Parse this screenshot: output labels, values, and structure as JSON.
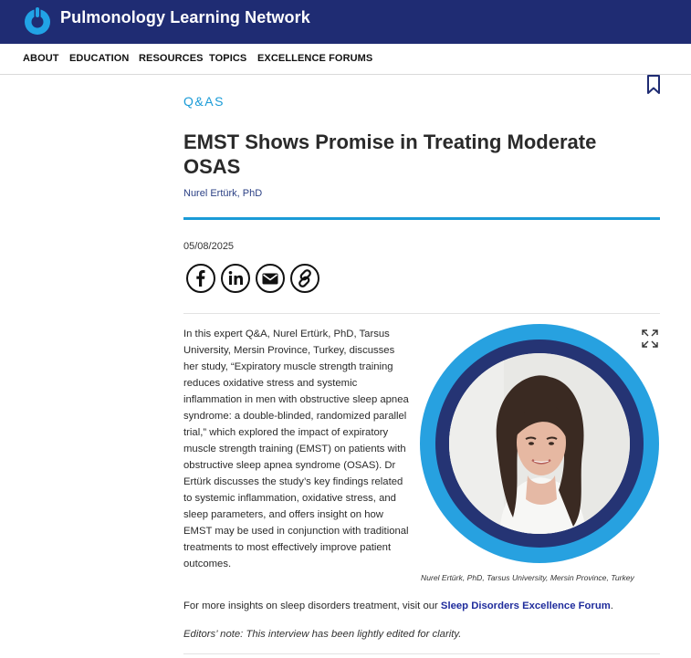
{
  "header": {
    "site_title": "Pulmonology Learning Network",
    "brand_color": "#1f2c73",
    "logo_icon": "lung-c-icon"
  },
  "nav": {
    "items": [
      {
        "label": "ABOUT"
      },
      {
        "label": "EDUCATION"
      },
      {
        "label": "RESOURCES"
      },
      {
        "label": "TOPICS"
      },
      {
        "label": "EXCELLENCE FORUMS"
      }
    ]
  },
  "article": {
    "category": "Q&AS",
    "title": "EMST Shows Promise in Treating Moderate OSAS",
    "author": "Nurel Ertürk, PhD",
    "date": "05/08/2025",
    "accent_color": "#1a9bd7",
    "share_icons": [
      "facebook-icon",
      "linkedin-icon",
      "email-icon",
      "link-icon"
    ],
    "bookmark_icon": "bookmark-icon",
    "expand_icon": "expand-icon",
    "body": "In this expert Q&A, Nurel Ertürk, PhD, Tarsus University, Mersin Province, Turkey, discusses her study, “Expiratory muscle strength training reduces oxidative stress and systemic inflammation in men with obstructive sleep apnea syndrome: a double-blinded, randomized parallel trial,” which explored the impact of expiratory muscle strength training (EMST) on patients with obstructive sleep apnea syndrome (OSAS). Dr Ertürk discusses the study’s key findings related to systemic inflammation, oxidative stress, and sleep parameters, and offers insight on how EMST may be used in conjunction with traditional treatments to most effectively improve patient outcomes.",
    "image_caption": "Nurel Ertürk, PhD, Tarsus University, Mersin Province, Turkey",
    "insights_prefix": "For more insights on sleep disorders treatment, visit our ",
    "insights_link": "Sleep Disorders Excellence Forum",
    "insights_suffix": ".",
    "editors_note": "Editors’ note: This interview has been lightly edited for clarity."
  }
}
